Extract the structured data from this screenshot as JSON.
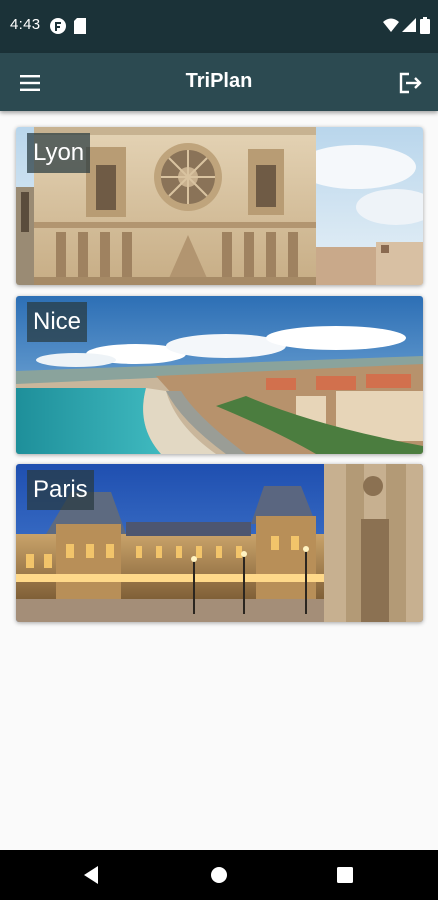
{
  "status_bar": {
    "time": "4:43",
    "icons_left": [
      "notification-app-icon",
      "sd-card-icon"
    ],
    "icons_right": [
      "wifi-icon",
      "signal-icon",
      "battery-icon"
    ]
  },
  "app_bar": {
    "title": "TriPlan",
    "menu_icon": "hamburger-menu-icon",
    "action_icon": "logout-icon"
  },
  "cities": [
    {
      "name": "Lyon",
      "image": "lyon-cathedral-photo"
    },
    {
      "name": "Nice",
      "image": "nice-beach-photo"
    },
    {
      "name": "Paris",
      "image": "paris-louvre-photo"
    }
  ],
  "nav_bar": {
    "buttons": [
      "back-icon",
      "home-icon",
      "recents-icon"
    ]
  },
  "colors": {
    "status_bar": "#1b3238",
    "app_bar": "#2c4a51",
    "background": "#fafafa"
  }
}
